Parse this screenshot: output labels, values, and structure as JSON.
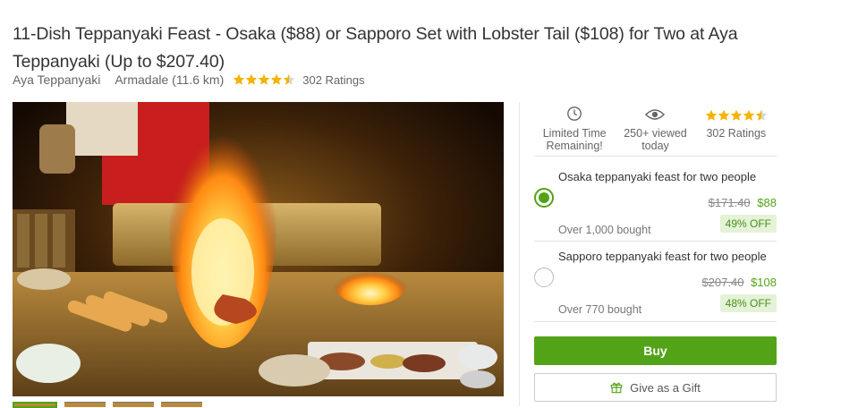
{
  "deal": {
    "title": "11-Dish Teppanyaki Feast - Osaka ($88) or Sapporo Set with Lobster Tail ($108) for Two at Aya Teppanyaki (Up to $207.40)",
    "merchant": "Aya Teppanyaki",
    "location": "Armadale (11.6 km)",
    "rating": 4.5,
    "ratings_count": "302 Ratings"
  },
  "gallery": {
    "thumbnails": [
      {
        "active": true
      },
      {
        "active": false
      },
      {
        "active": false
      },
      {
        "active": false
      }
    ]
  },
  "stats": {
    "limited_line1": "Limited Time",
    "limited_line2": "Remaining!",
    "viewed_line1": "250+ viewed",
    "viewed_line2": "today",
    "rating_label": "302 Ratings"
  },
  "options": [
    {
      "name": "Osaka teppanyaki feast for two people",
      "original_price": "$171.40",
      "price": "$88",
      "bought": "Over 1,000 bought",
      "discount": "49% OFF",
      "selected": true
    },
    {
      "name": "Sapporo teppanyaki feast for two people",
      "original_price": "$207.40",
      "price": "$108",
      "bought": "Over 770 bought",
      "discount": "48% OFF",
      "selected": false
    }
  ],
  "actions": {
    "buy_label": "Buy",
    "gift_label": "Give as a Gift"
  },
  "colors": {
    "accent": "#53a318",
    "star": "#f5b301",
    "discount_bg": "#e4f2d7"
  },
  "icons": {
    "clock": "clock-icon",
    "eye": "eye-icon",
    "star": "star-icon",
    "gift": "gift-icon"
  }
}
